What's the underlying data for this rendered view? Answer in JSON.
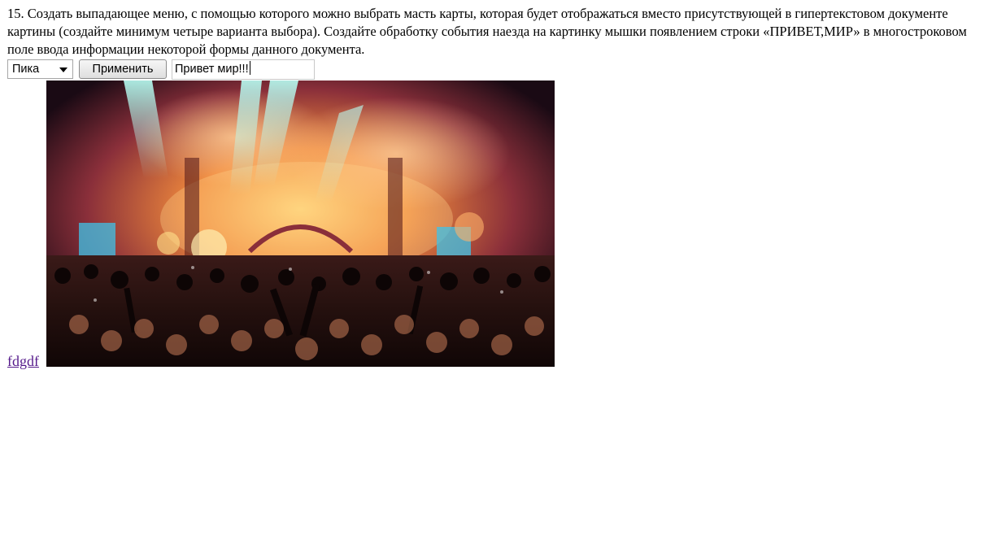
{
  "task": {
    "text": "15. Создать выпадающее меню, с помощью которого можно выбрать масть карты, которая будет отображаться вместо присутствующей в гипертекстовом документе картины (создайте минимум четыре варианта выбора). Создайте обработку события наезда на картинку мышки появлением строки «ПРИВЕТ,МИР» в многостроковом поле ввода информации некоторой формы данного документа."
  },
  "form": {
    "suit_selected": "Пика",
    "apply_label": "Применить",
    "message_value": "Привет мир!!!"
  },
  "content": {
    "link_text": "fdgdf"
  }
}
